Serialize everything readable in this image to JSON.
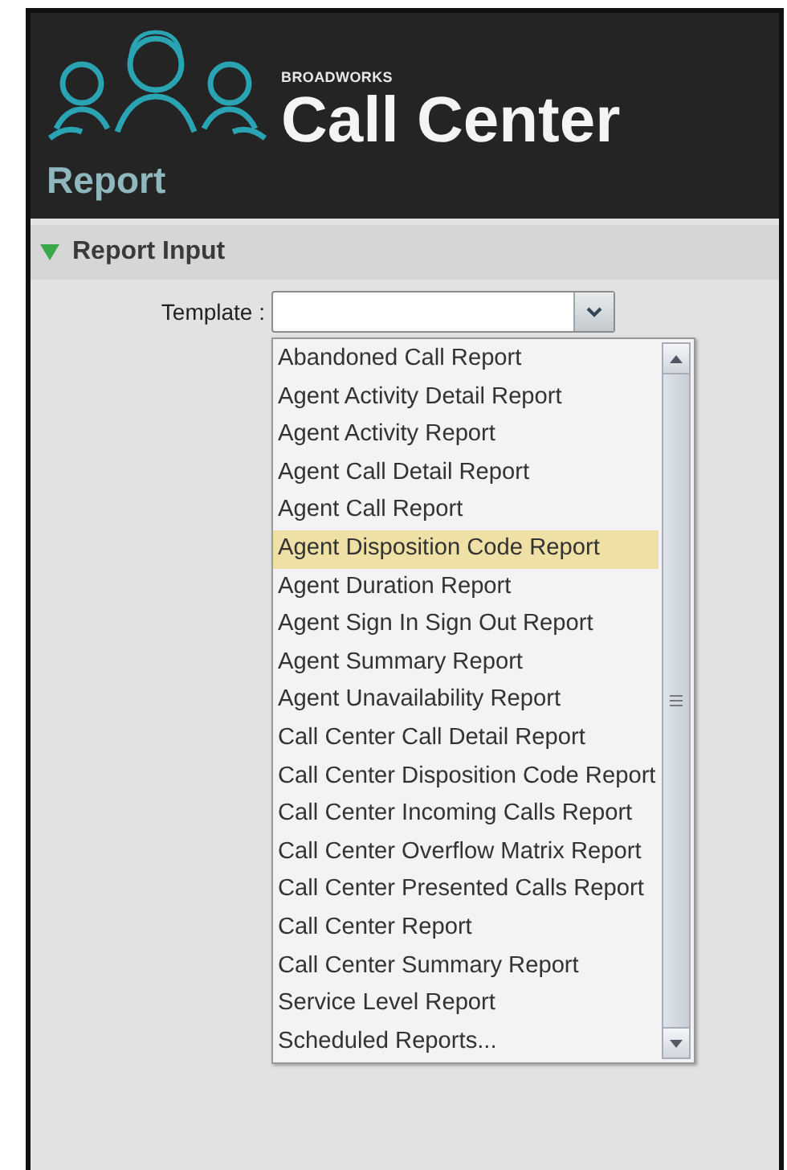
{
  "header": {
    "brand": "BROADWORKS",
    "product": "Call Center",
    "title": "Report"
  },
  "section": {
    "label": "Report Input",
    "expanded": true
  },
  "template": {
    "label": "Template :",
    "open": true
  },
  "options": [
    {
      "label": "Abandoned Call Report",
      "selected": false
    },
    {
      "label": "Agent Activity Detail Report",
      "selected": false
    },
    {
      "label": "Agent Activity Report",
      "selected": false
    },
    {
      "label": "Agent Call Detail Report",
      "selected": false
    },
    {
      "label": "Agent Call Report",
      "selected": false
    },
    {
      "label": "Agent Disposition Code Report",
      "selected": true
    },
    {
      "label": "Agent Duration Report",
      "selected": false
    },
    {
      "label": "Agent Sign In Sign Out Report",
      "selected": false
    },
    {
      "label": "Agent Summary Report",
      "selected": false
    },
    {
      "label": "Agent Unavailability Report",
      "selected": false
    },
    {
      "label": "Call Center Call Detail Report",
      "selected": false
    },
    {
      "label": "Call Center Disposition Code Report",
      "selected": false
    },
    {
      "label": "Call Center Incoming Calls Report",
      "selected": false
    },
    {
      "label": "Call Center Overflow Matrix Report",
      "selected": false
    },
    {
      "label": "Call Center Presented Calls Report",
      "selected": false
    },
    {
      "label": "Call Center Report",
      "selected": false
    },
    {
      "label": "Call Center Summary Report",
      "selected": false
    },
    {
      "label": "Service Level Report",
      "selected": false
    },
    {
      "label": "Scheduled Reports...",
      "selected": false
    }
  ]
}
